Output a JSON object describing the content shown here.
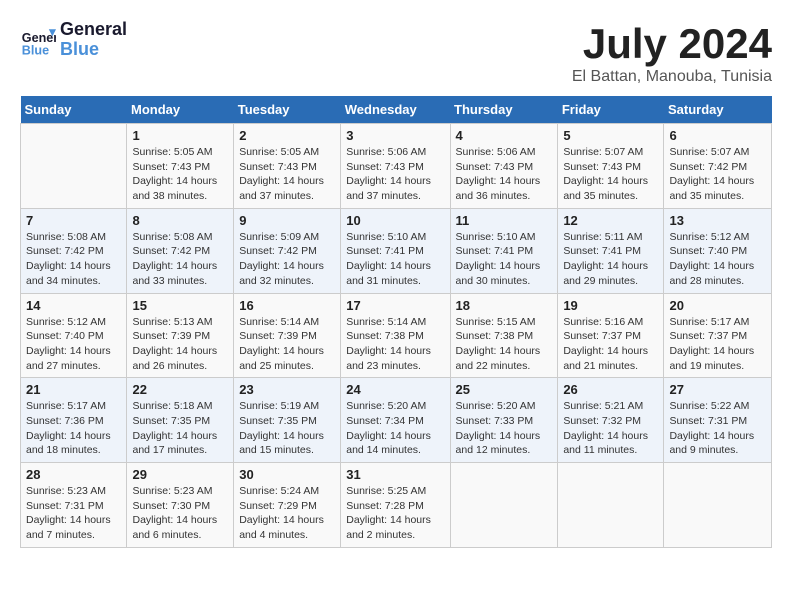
{
  "header": {
    "logo_line1": "General",
    "logo_line2": "Blue",
    "main_title": "July 2024",
    "subtitle": "El Battan, Manouba, Tunisia"
  },
  "columns": [
    "Sunday",
    "Monday",
    "Tuesday",
    "Wednesday",
    "Thursday",
    "Friday",
    "Saturday"
  ],
  "weeks": [
    [
      {
        "day": "",
        "info": ""
      },
      {
        "day": "1",
        "info": "Sunrise: 5:05 AM\nSunset: 7:43 PM\nDaylight: 14 hours\nand 38 minutes."
      },
      {
        "day": "2",
        "info": "Sunrise: 5:05 AM\nSunset: 7:43 PM\nDaylight: 14 hours\nand 37 minutes."
      },
      {
        "day": "3",
        "info": "Sunrise: 5:06 AM\nSunset: 7:43 PM\nDaylight: 14 hours\nand 37 minutes."
      },
      {
        "day": "4",
        "info": "Sunrise: 5:06 AM\nSunset: 7:43 PM\nDaylight: 14 hours\nand 36 minutes."
      },
      {
        "day": "5",
        "info": "Sunrise: 5:07 AM\nSunset: 7:43 PM\nDaylight: 14 hours\nand 35 minutes."
      },
      {
        "day": "6",
        "info": "Sunrise: 5:07 AM\nSunset: 7:42 PM\nDaylight: 14 hours\nand 35 minutes."
      }
    ],
    [
      {
        "day": "7",
        "info": "Sunrise: 5:08 AM\nSunset: 7:42 PM\nDaylight: 14 hours\nand 34 minutes."
      },
      {
        "day": "8",
        "info": "Sunrise: 5:08 AM\nSunset: 7:42 PM\nDaylight: 14 hours\nand 33 minutes."
      },
      {
        "day": "9",
        "info": "Sunrise: 5:09 AM\nSunset: 7:42 PM\nDaylight: 14 hours\nand 32 minutes."
      },
      {
        "day": "10",
        "info": "Sunrise: 5:10 AM\nSunset: 7:41 PM\nDaylight: 14 hours\nand 31 minutes."
      },
      {
        "day": "11",
        "info": "Sunrise: 5:10 AM\nSunset: 7:41 PM\nDaylight: 14 hours\nand 30 minutes."
      },
      {
        "day": "12",
        "info": "Sunrise: 5:11 AM\nSunset: 7:41 PM\nDaylight: 14 hours\nand 29 minutes."
      },
      {
        "day": "13",
        "info": "Sunrise: 5:12 AM\nSunset: 7:40 PM\nDaylight: 14 hours\nand 28 minutes."
      }
    ],
    [
      {
        "day": "14",
        "info": "Sunrise: 5:12 AM\nSunset: 7:40 PM\nDaylight: 14 hours\nand 27 minutes."
      },
      {
        "day": "15",
        "info": "Sunrise: 5:13 AM\nSunset: 7:39 PM\nDaylight: 14 hours\nand 26 minutes."
      },
      {
        "day": "16",
        "info": "Sunrise: 5:14 AM\nSunset: 7:39 PM\nDaylight: 14 hours\nand 25 minutes."
      },
      {
        "day": "17",
        "info": "Sunrise: 5:14 AM\nSunset: 7:38 PM\nDaylight: 14 hours\nand 23 minutes."
      },
      {
        "day": "18",
        "info": "Sunrise: 5:15 AM\nSunset: 7:38 PM\nDaylight: 14 hours\nand 22 minutes."
      },
      {
        "day": "19",
        "info": "Sunrise: 5:16 AM\nSunset: 7:37 PM\nDaylight: 14 hours\nand 21 minutes."
      },
      {
        "day": "20",
        "info": "Sunrise: 5:17 AM\nSunset: 7:37 PM\nDaylight: 14 hours\nand 19 minutes."
      }
    ],
    [
      {
        "day": "21",
        "info": "Sunrise: 5:17 AM\nSunset: 7:36 PM\nDaylight: 14 hours\nand 18 minutes."
      },
      {
        "day": "22",
        "info": "Sunrise: 5:18 AM\nSunset: 7:35 PM\nDaylight: 14 hours\nand 17 minutes."
      },
      {
        "day": "23",
        "info": "Sunrise: 5:19 AM\nSunset: 7:35 PM\nDaylight: 14 hours\nand 15 minutes."
      },
      {
        "day": "24",
        "info": "Sunrise: 5:20 AM\nSunset: 7:34 PM\nDaylight: 14 hours\nand 14 minutes."
      },
      {
        "day": "25",
        "info": "Sunrise: 5:20 AM\nSunset: 7:33 PM\nDaylight: 14 hours\nand 12 minutes."
      },
      {
        "day": "26",
        "info": "Sunrise: 5:21 AM\nSunset: 7:32 PM\nDaylight: 14 hours\nand 11 minutes."
      },
      {
        "day": "27",
        "info": "Sunrise: 5:22 AM\nSunset: 7:31 PM\nDaylight: 14 hours\nand 9 minutes."
      }
    ],
    [
      {
        "day": "28",
        "info": "Sunrise: 5:23 AM\nSunset: 7:31 PM\nDaylight: 14 hours\nand 7 minutes."
      },
      {
        "day": "29",
        "info": "Sunrise: 5:23 AM\nSunset: 7:30 PM\nDaylight: 14 hours\nand 6 minutes."
      },
      {
        "day": "30",
        "info": "Sunrise: 5:24 AM\nSunset: 7:29 PM\nDaylight: 14 hours\nand 4 minutes."
      },
      {
        "day": "31",
        "info": "Sunrise: 5:25 AM\nSunset: 7:28 PM\nDaylight: 14 hours\nand 2 minutes."
      },
      {
        "day": "",
        "info": ""
      },
      {
        "day": "",
        "info": ""
      },
      {
        "day": "",
        "info": ""
      }
    ]
  ]
}
